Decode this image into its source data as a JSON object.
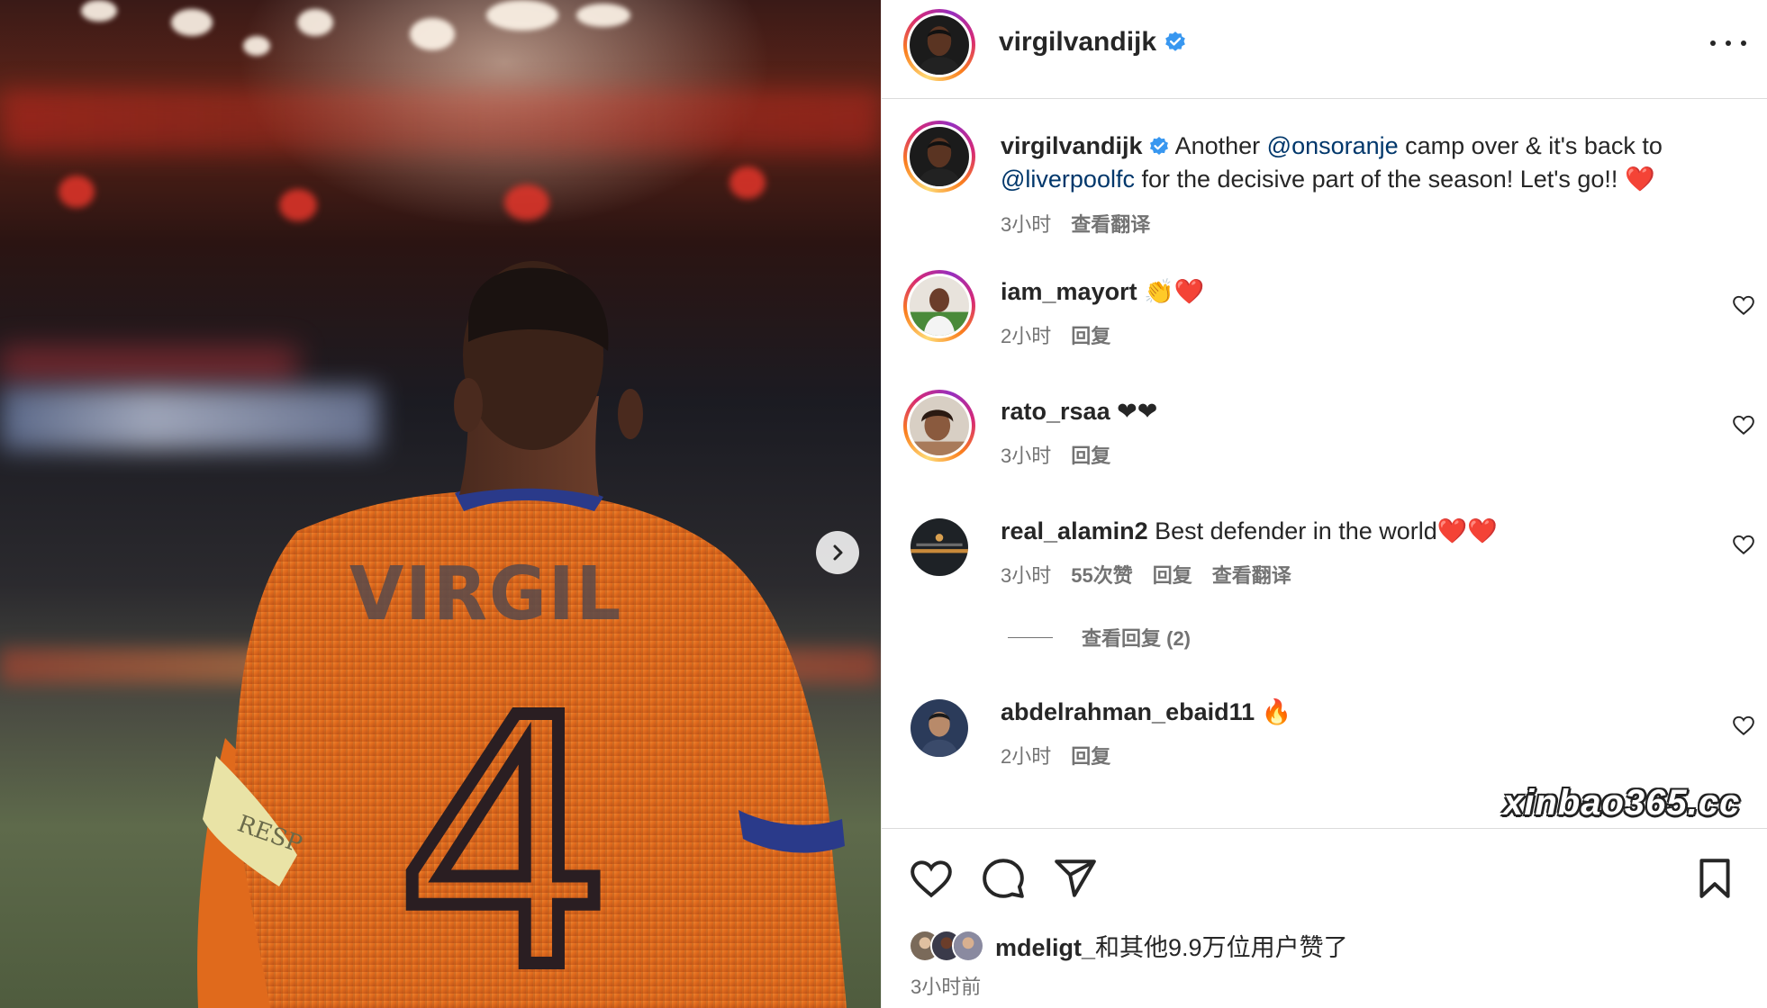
{
  "post": {
    "username": "virgilvandijk",
    "verified": true,
    "caption": {
      "username": "virgilvandijk",
      "text_1": " Another ",
      "mention_1": "@onsoranje",
      "text_2": " camp over & it's back to ",
      "mention_2": "@liverpoolfc",
      "text_3": " for the decisive part of the season! Let's go!! ",
      "emoji": "❤️",
      "time": "3小时",
      "translate": "查看翻译"
    }
  },
  "photo": {
    "jersey_name": "VIRGIL",
    "jersey_number": "4",
    "armband_text": "RESP"
  },
  "comments": [
    {
      "username": "iam_mayort",
      "text": " 👏❤️",
      "time": "2小时",
      "reply": "回复"
    },
    {
      "username": "rato_rsaa",
      "text": " ❤❤",
      "time": "3小时",
      "reply": "回复"
    },
    {
      "username": "real_alamin2",
      "text": " Best defender in the world❤️❤️",
      "time": "3小时",
      "likes": "55次赞",
      "reply": "回复",
      "translate": "查看翻译",
      "view_replies": "查看回复 (2)"
    },
    {
      "username": "abdelrahman_ebaid11",
      "text": " 🔥",
      "time": "2小时",
      "reply": "回复"
    }
  ],
  "footer": {
    "likes_user": "mdeligt_",
    "likes_rest": "和其他9.9万位用户赞了",
    "time_ago": "3小时前"
  },
  "watermark": "xinbao365.cc",
  "colors": {
    "link": "#00376b",
    "verified": "#3897f0",
    "muted": "#737373",
    "jersey": "#e06a1c"
  }
}
